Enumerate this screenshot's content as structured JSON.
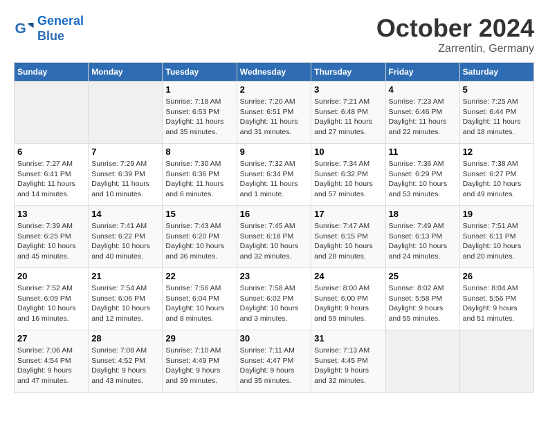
{
  "logo": {
    "line1": "General",
    "line2": "Blue"
  },
  "title": "October 2024",
  "subtitle": "Zarrentin, Germany",
  "days_of_week": [
    "Sunday",
    "Monday",
    "Tuesday",
    "Wednesday",
    "Thursday",
    "Friday",
    "Saturday"
  ],
  "weeks": [
    [
      {
        "num": "",
        "info": ""
      },
      {
        "num": "",
        "info": ""
      },
      {
        "num": "1",
        "info": "Sunrise: 7:18 AM\nSunset: 6:53 PM\nDaylight: 11 hours and 35 minutes."
      },
      {
        "num": "2",
        "info": "Sunrise: 7:20 AM\nSunset: 6:51 PM\nDaylight: 11 hours and 31 minutes."
      },
      {
        "num": "3",
        "info": "Sunrise: 7:21 AM\nSunset: 6:48 PM\nDaylight: 11 hours and 27 minutes."
      },
      {
        "num": "4",
        "info": "Sunrise: 7:23 AM\nSunset: 6:46 PM\nDaylight: 11 hours and 22 minutes."
      },
      {
        "num": "5",
        "info": "Sunrise: 7:25 AM\nSunset: 6:44 PM\nDaylight: 11 hours and 18 minutes."
      }
    ],
    [
      {
        "num": "6",
        "info": "Sunrise: 7:27 AM\nSunset: 6:41 PM\nDaylight: 11 hours and 14 minutes."
      },
      {
        "num": "7",
        "info": "Sunrise: 7:29 AM\nSunset: 6:39 PM\nDaylight: 11 hours and 10 minutes."
      },
      {
        "num": "8",
        "info": "Sunrise: 7:30 AM\nSunset: 6:36 PM\nDaylight: 11 hours and 6 minutes."
      },
      {
        "num": "9",
        "info": "Sunrise: 7:32 AM\nSunset: 6:34 PM\nDaylight: 11 hours and 1 minute."
      },
      {
        "num": "10",
        "info": "Sunrise: 7:34 AM\nSunset: 6:32 PM\nDaylight: 10 hours and 57 minutes."
      },
      {
        "num": "11",
        "info": "Sunrise: 7:36 AM\nSunset: 6:29 PM\nDaylight: 10 hours and 53 minutes."
      },
      {
        "num": "12",
        "info": "Sunrise: 7:38 AM\nSunset: 6:27 PM\nDaylight: 10 hours and 49 minutes."
      }
    ],
    [
      {
        "num": "13",
        "info": "Sunrise: 7:39 AM\nSunset: 6:25 PM\nDaylight: 10 hours and 45 minutes."
      },
      {
        "num": "14",
        "info": "Sunrise: 7:41 AM\nSunset: 6:22 PM\nDaylight: 10 hours and 40 minutes."
      },
      {
        "num": "15",
        "info": "Sunrise: 7:43 AM\nSunset: 6:20 PM\nDaylight: 10 hours and 36 minutes."
      },
      {
        "num": "16",
        "info": "Sunrise: 7:45 AM\nSunset: 6:18 PM\nDaylight: 10 hours and 32 minutes."
      },
      {
        "num": "17",
        "info": "Sunrise: 7:47 AM\nSunset: 6:15 PM\nDaylight: 10 hours and 28 minutes."
      },
      {
        "num": "18",
        "info": "Sunrise: 7:49 AM\nSunset: 6:13 PM\nDaylight: 10 hours and 24 minutes."
      },
      {
        "num": "19",
        "info": "Sunrise: 7:51 AM\nSunset: 6:11 PM\nDaylight: 10 hours and 20 minutes."
      }
    ],
    [
      {
        "num": "20",
        "info": "Sunrise: 7:52 AM\nSunset: 6:09 PM\nDaylight: 10 hours and 16 minutes."
      },
      {
        "num": "21",
        "info": "Sunrise: 7:54 AM\nSunset: 6:06 PM\nDaylight: 10 hours and 12 minutes."
      },
      {
        "num": "22",
        "info": "Sunrise: 7:56 AM\nSunset: 6:04 PM\nDaylight: 10 hours and 8 minutes."
      },
      {
        "num": "23",
        "info": "Sunrise: 7:58 AM\nSunset: 6:02 PM\nDaylight: 10 hours and 3 minutes."
      },
      {
        "num": "24",
        "info": "Sunrise: 8:00 AM\nSunset: 6:00 PM\nDaylight: 9 hours and 59 minutes."
      },
      {
        "num": "25",
        "info": "Sunrise: 8:02 AM\nSunset: 5:58 PM\nDaylight: 9 hours and 55 minutes."
      },
      {
        "num": "26",
        "info": "Sunrise: 8:04 AM\nSunset: 5:56 PM\nDaylight: 9 hours and 51 minutes."
      }
    ],
    [
      {
        "num": "27",
        "info": "Sunrise: 7:06 AM\nSunset: 4:54 PM\nDaylight: 9 hours and 47 minutes."
      },
      {
        "num": "28",
        "info": "Sunrise: 7:08 AM\nSunset: 4:52 PM\nDaylight: 9 hours and 43 minutes."
      },
      {
        "num": "29",
        "info": "Sunrise: 7:10 AM\nSunset: 4:49 PM\nDaylight: 9 hours and 39 minutes."
      },
      {
        "num": "30",
        "info": "Sunrise: 7:11 AM\nSunset: 4:47 PM\nDaylight: 9 hours and 35 minutes."
      },
      {
        "num": "31",
        "info": "Sunrise: 7:13 AM\nSunset: 4:45 PM\nDaylight: 9 hours and 32 minutes."
      },
      {
        "num": "",
        "info": ""
      },
      {
        "num": "",
        "info": ""
      }
    ]
  ]
}
